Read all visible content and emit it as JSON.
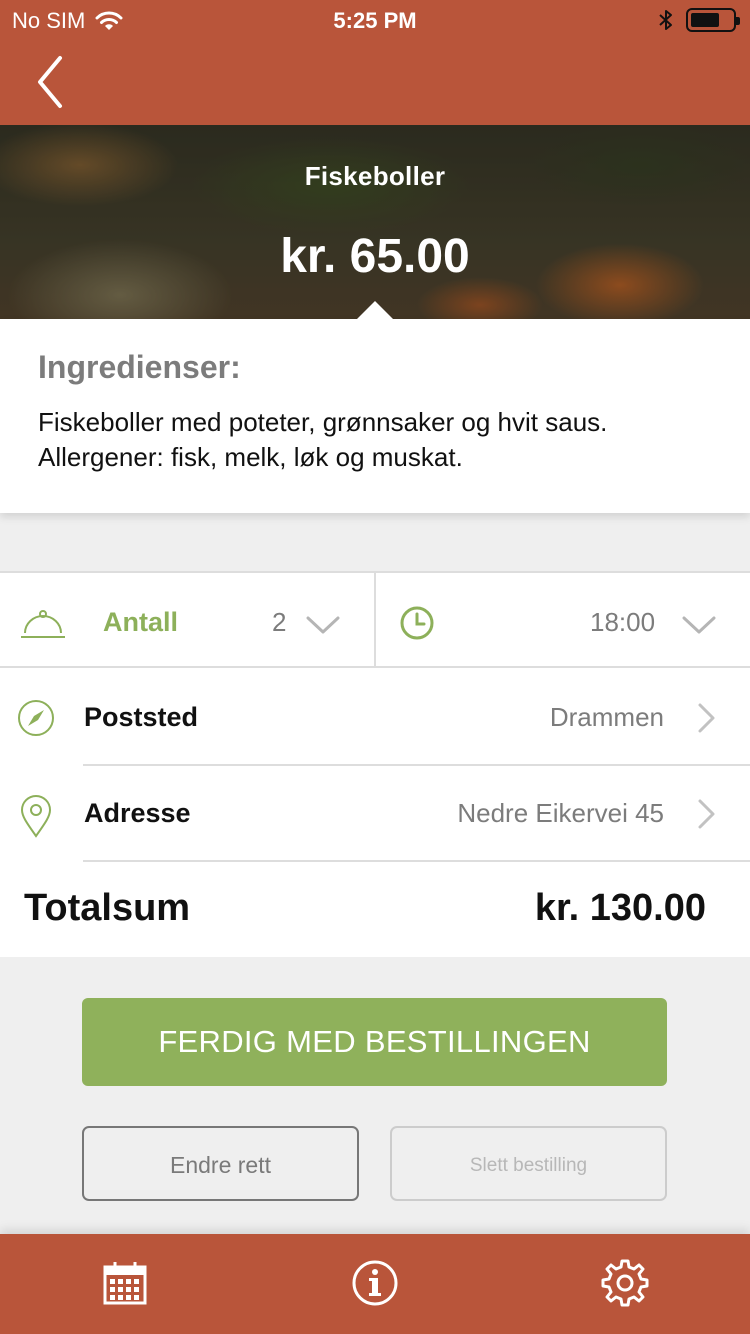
{
  "status_bar": {
    "carrier": "No SIM",
    "time": "5:25 PM"
  },
  "hero": {
    "title": "Fiskeboller",
    "price": "kr. 65.00"
  },
  "ingredients": {
    "heading": "Ingredienser:",
    "text": "Fiskeboller med poteter, grønnsaker og hvit saus. Allergener: fisk, melk, løk og muskat."
  },
  "order": {
    "quantity_label": "Antall",
    "quantity_value": "2",
    "time_value": "18:00",
    "postal_label": "Poststed",
    "postal_value": "Drammen",
    "address_label": "Adresse",
    "address_value": "Nedre Eikervei 45",
    "total_label": "Totalsum",
    "total_value": "kr. 130.00"
  },
  "buttons": {
    "finish": "FERDIG MED BESTILLINGEN",
    "edit": "Endre rett",
    "delete": "Slett bestilling"
  },
  "colors": {
    "brand": "#b9553a",
    "accent_green": "#8fb15b"
  },
  "tab_bar": {
    "icons": [
      "calendar-icon",
      "info-icon",
      "settings-gear-icon"
    ]
  }
}
